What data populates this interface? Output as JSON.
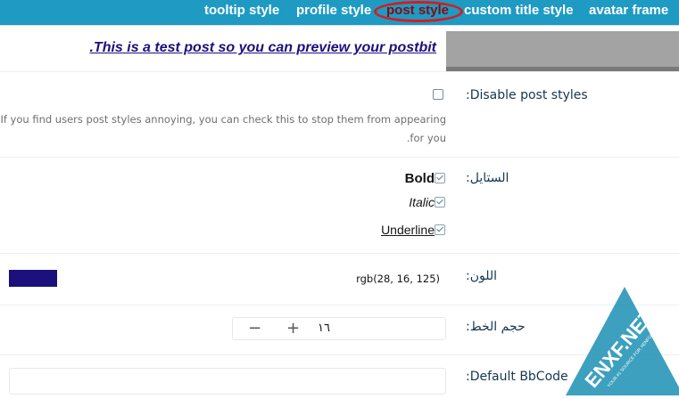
{
  "tabs": [
    {
      "label": "tooltip style"
    },
    {
      "label": "profile style"
    },
    {
      "label": "post style"
    },
    {
      "label": "custom title style"
    },
    {
      "label": "avatar frame"
    }
  ],
  "preview_text": ".This is a test post so you can preview your postbit",
  "disable_styles": {
    "label": ":Disable post styles",
    "checked": false,
    "hint_line1": "If you find users post styles annoying, you can check this to stop them from appearing",
    "hint_line2": ".for you"
  },
  "style": {
    "label": ":الستايل",
    "options": [
      {
        "label": "Bold",
        "checked": true
      },
      {
        "label": "Italic",
        "checked": true
      },
      {
        "label": "Underline",
        "checked": true
      }
    ]
  },
  "color": {
    "label": ":اللون",
    "value": "rgb(28, 16, 125)",
    "swatch": "#1c107d"
  },
  "font_size": {
    "label": ":حجم الخط",
    "value": "١٦",
    "minus": "−",
    "plus": "+"
  },
  "bbcode": {
    "label": ":Default BbCode",
    "value": ""
  },
  "watermark": {
    "brand": "ENXF.NET",
    "tagline": "YOUR #1 SOURCE FOR XENFORO"
  }
}
